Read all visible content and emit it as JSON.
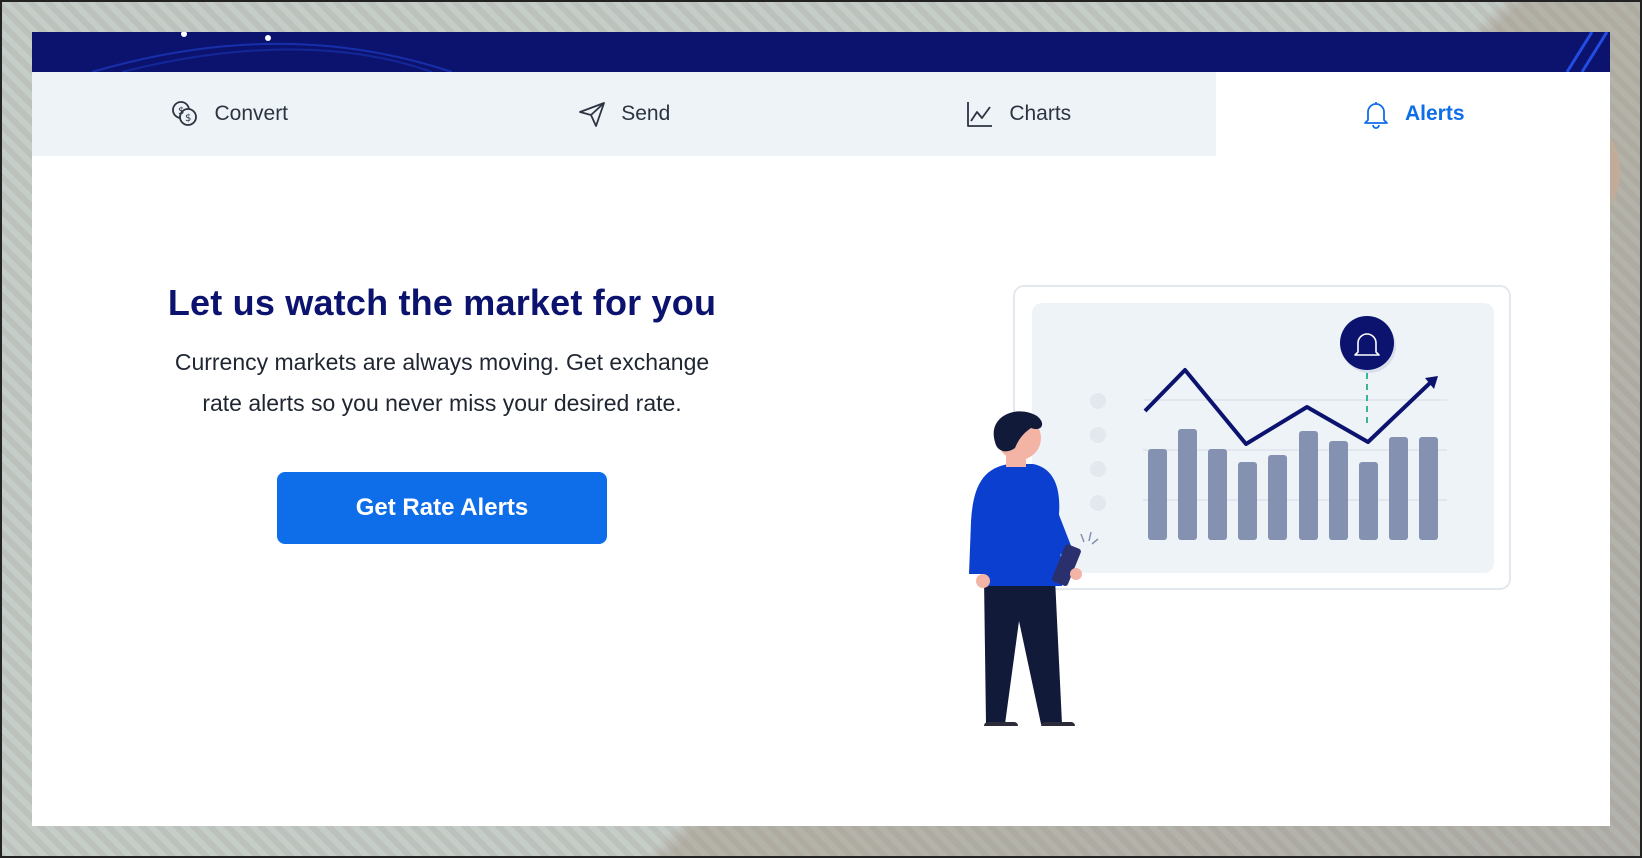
{
  "tabs": [
    {
      "label": "Convert",
      "icon": "coins-icon",
      "active": false
    },
    {
      "label": "Send",
      "icon": "paper-plane-icon",
      "active": false
    },
    {
      "label": "Charts",
      "icon": "line-chart-icon",
      "active": false
    },
    {
      "label": "Alerts",
      "icon": "bell-icon",
      "active": true
    }
  ],
  "hero": {
    "title": "Let us watch the market for you",
    "description_line1": "Currency markets are always moving. Get exchange",
    "description_line2": "rate alerts so you never miss your desired rate.",
    "cta_label": "Get Rate Alerts"
  },
  "colors": {
    "navy": "#0b136f",
    "accent_blue": "#0e6de9",
    "tab_bg": "#eef3f8",
    "bar_gray": "#8591b1",
    "person_blue": "#0b3fd0"
  }
}
